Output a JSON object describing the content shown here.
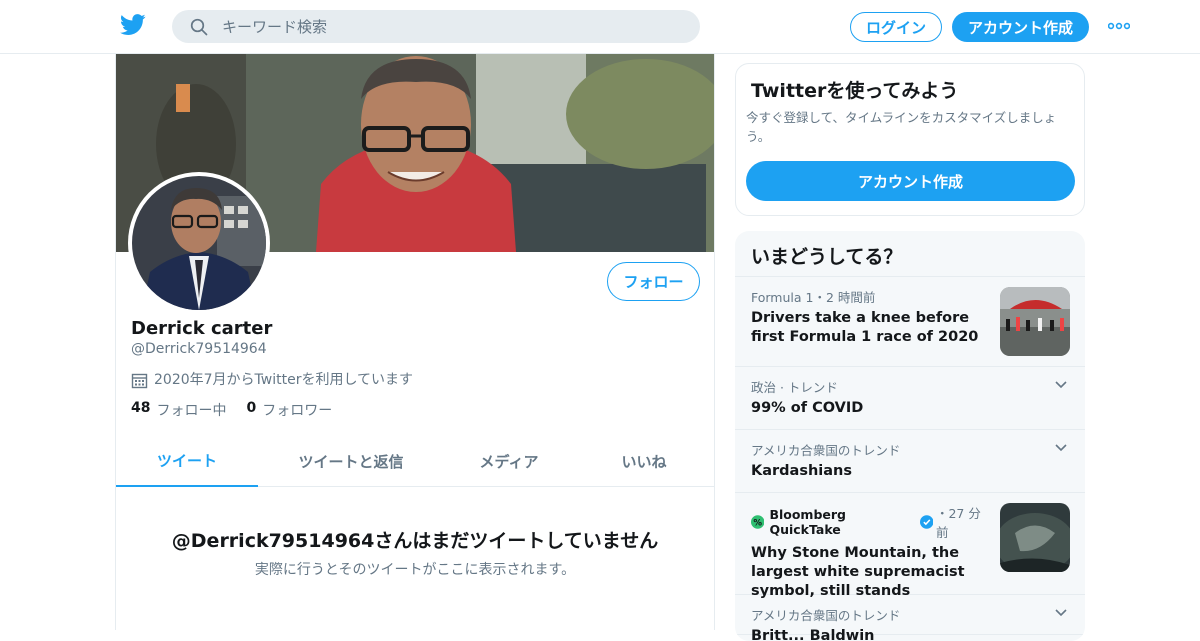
{
  "header": {
    "search_placeholder": "キーワード検索",
    "login_label": "ログイン",
    "signup_label": "アカウント作成"
  },
  "profile": {
    "display_name": "Derrick carter",
    "handle": "@Derrick79514964",
    "joined": "2020年7月からTwitterを利用しています",
    "following_count": "48",
    "following_label": "フォロー中",
    "followers_count": "0",
    "followers_label": "フォロワー",
    "follow_button": "フォロー"
  },
  "tabs": [
    {
      "label": "ツイート",
      "active": true
    },
    {
      "label": "ツイートと返信",
      "active": false
    },
    {
      "label": "メディア",
      "active": false
    },
    {
      "label": "いいね",
      "active": false
    }
  ],
  "empty_state": {
    "title": "@Derrick79514964さんはまだツイートしていません",
    "subtitle": "実際に行うとそのツイートがここに表示されます。"
  },
  "signup_card": {
    "title": "Twitterを使ってみよう",
    "description": "今すぐ登録して、タイムラインをカスタマイズしましょう。",
    "button": "アカウント作成"
  },
  "trends": {
    "title": "いまどうしてる？",
    "items": [
      {
        "meta": "Formula 1・2 時間前",
        "headline": "Drivers take a knee before first Formula 1 race of 2020"
      },
      {
        "meta": "政治 · トレンド",
        "headline": "99% of COVID"
      },
      {
        "meta": "アメリカ合衆国のトレンド",
        "headline": "Kardashians"
      },
      {
        "source": "Bloomberg QuickTake",
        "time": "・27 分前",
        "headline": "Why Stone Mountain, the largest white supremacist symbol, still stands"
      },
      {
        "meta": "アメリカ合衆国のトレンド",
        "headline": "Britt... Baldwin"
      }
    ]
  },
  "colors": {
    "accent": "#1da1f2",
    "text_primary": "#14171a",
    "text_secondary": "#657786",
    "border": "#e6ecf0",
    "panel_bg": "#f5f8fa"
  },
  "icons": [
    "twitter-bird-icon",
    "search-icon",
    "more-dots-icon",
    "calendar-icon",
    "chevron-down-icon",
    "verified-badge-icon",
    "bloomberg-icon"
  ]
}
